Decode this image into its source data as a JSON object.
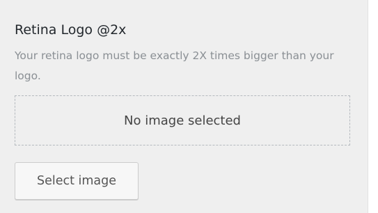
{
  "control": {
    "title": "Retina Logo @2x",
    "description": "Your retina logo must be exactly 2X times bigger than your logo.",
    "placeholder": "No image selected",
    "select_button_label": "Select image"
  }
}
